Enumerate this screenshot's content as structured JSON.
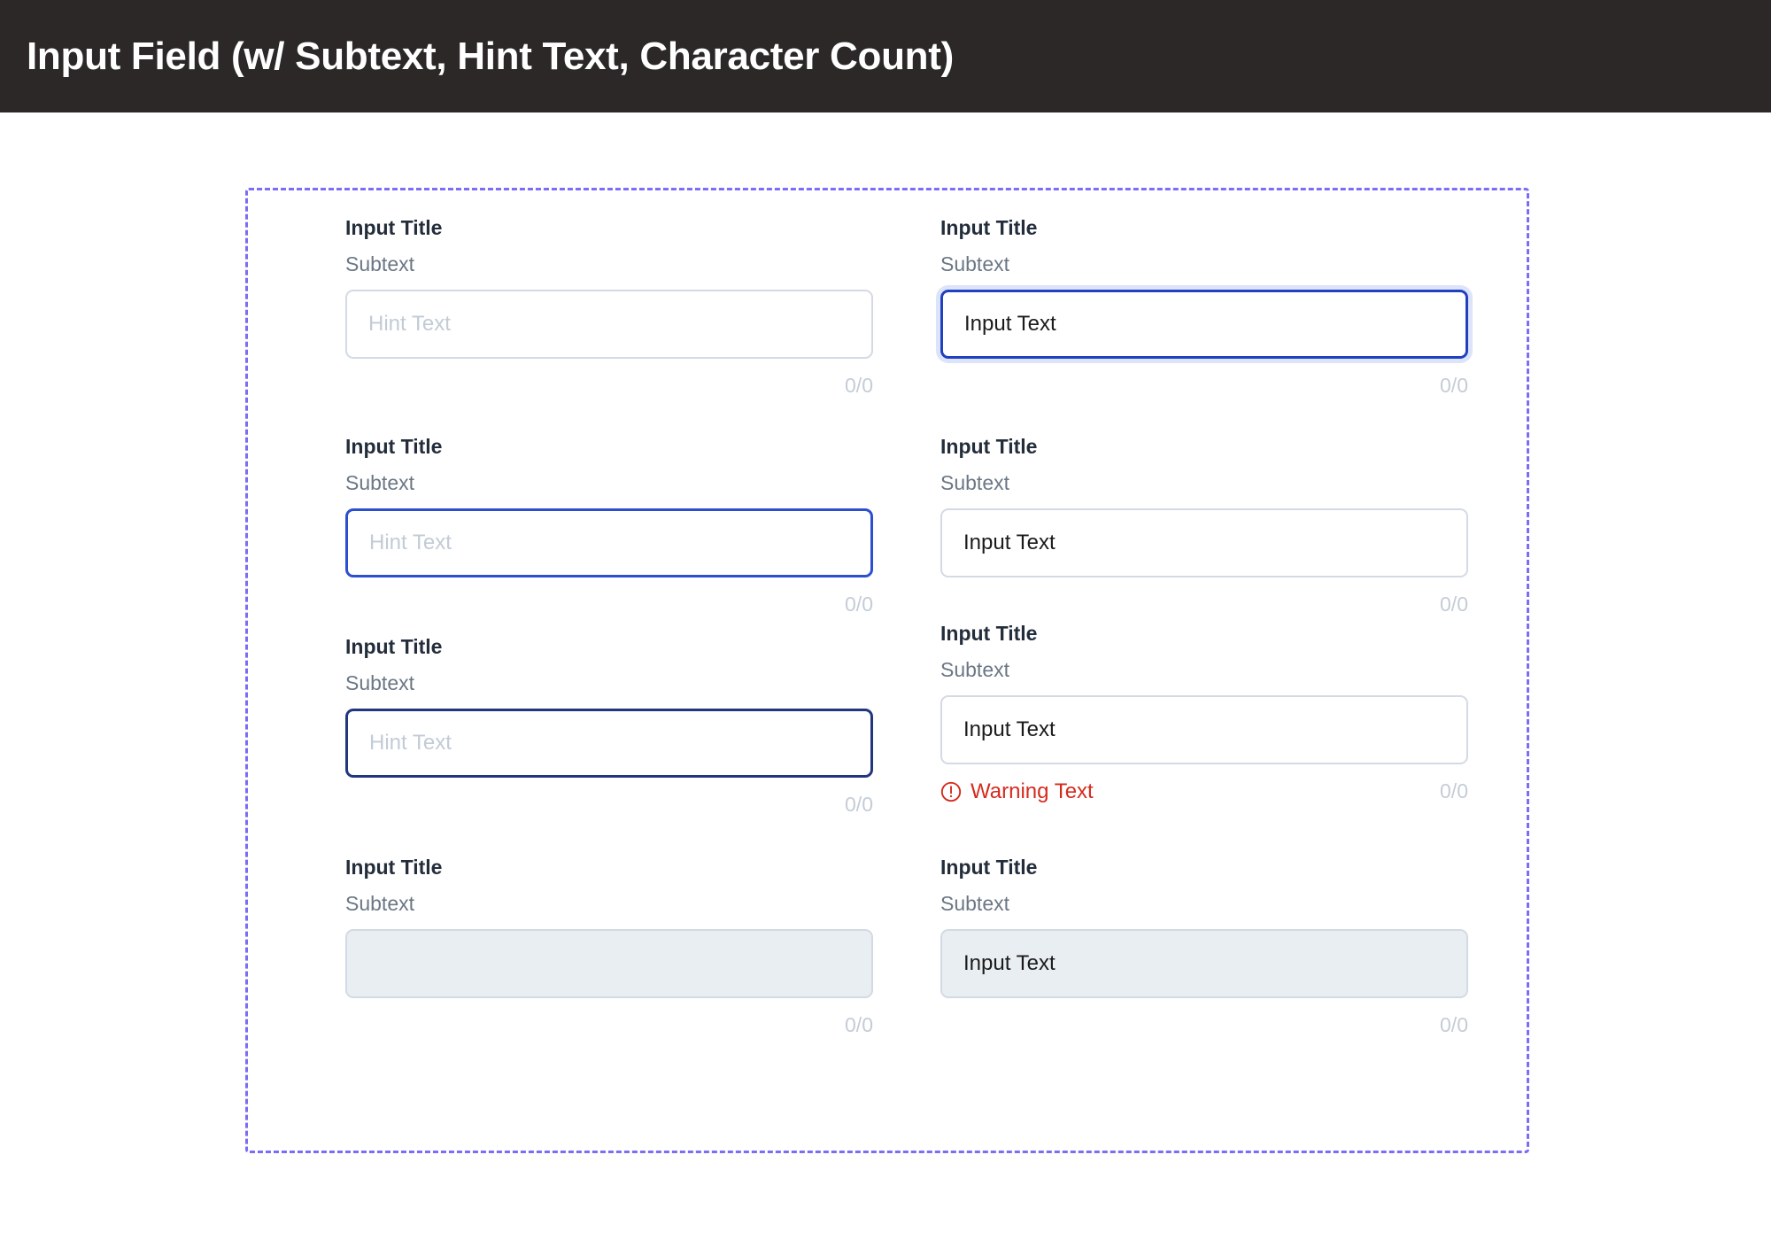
{
  "header": {
    "title": "Input Field (w/ Subtext, Hint Text, Character Count)"
  },
  "labels": {
    "title": "Input Title",
    "subtext": "Subtext",
    "hint": "Hint Text",
    "value": "Input Text",
    "warning": "Warning Text",
    "count": "0/0"
  },
  "colors": {
    "header_bg": "#2b2827",
    "frame_dashed": "#7a6df6",
    "border_default": "#d3dae3",
    "border_focus": "#2040c0",
    "focus_ring": "#dde4fa",
    "border_active": "#2b4fd0",
    "border_pressed": "#22357f",
    "disabled_bg": "#e9eef3",
    "title_text": "#232d3b",
    "subtext": "#6b7786",
    "placeholder": "#c2cbd6",
    "value_text": "#1b1b1b",
    "warning_text": "#d52b1e",
    "count_text": "#c4ccd6"
  },
  "fields": {
    "left": [
      {
        "title": "Input Title",
        "subtext": "Subtext",
        "state": "default",
        "text": "Hint Text",
        "filled": false,
        "count": "0/0",
        "warning": null
      },
      {
        "title": "Input Title",
        "subtext": "Subtext",
        "state": "active",
        "text": "Hint Text",
        "filled": false,
        "count": "0/0",
        "warning": null
      },
      {
        "title": "Input Title",
        "subtext": "Subtext",
        "state": "pressed",
        "text": "Hint Text",
        "filled": false,
        "count": "0/0",
        "warning": null
      },
      {
        "title": "Input Title",
        "subtext": "Subtext",
        "state": "disabled",
        "text": "",
        "filled": false,
        "count": "0/0",
        "warning": null
      }
    ],
    "right": [
      {
        "title": "Input Title",
        "subtext": "Subtext",
        "state": "focus",
        "text": "Input Text",
        "filled": true,
        "count": "0/0",
        "warning": null
      },
      {
        "title": "Input Title",
        "subtext": "Subtext",
        "state": "default",
        "text": "Input Text",
        "filled": true,
        "count": "0/0",
        "warning": null
      },
      {
        "title": "Input Title",
        "subtext": "Subtext",
        "state": "default",
        "text": "Input Text",
        "filled": true,
        "count": "0/0",
        "warning": "Warning Text"
      },
      {
        "title": "Input Title",
        "subtext": "Subtext",
        "state": "disabled",
        "text": "Input Text",
        "filled": true,
        "count": "0/0",
        "warning": null
      }
    ]
  },
  "layout": {
    "left_tops": [
      30,
      277,
      503,
      752
    ],
    "right_tops": [
      30,
      277,
      488,
      752
    ]
  }
}
